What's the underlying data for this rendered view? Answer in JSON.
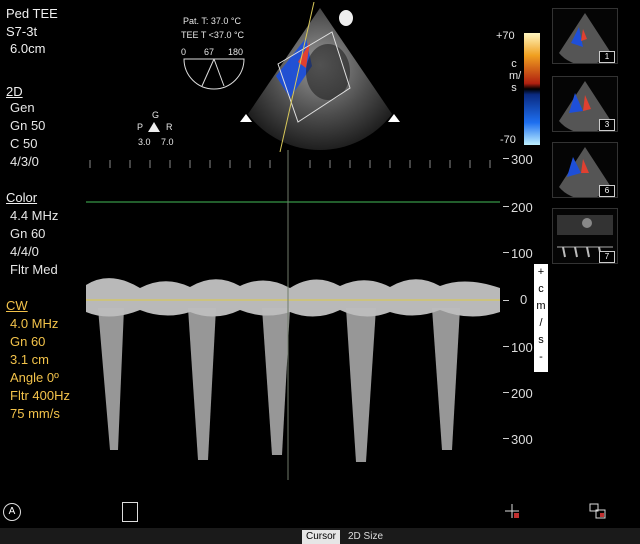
{
  "header": {
    "preset": "Ped TEE",
    "probe": "S7-3t",
    "depth": "6.0cm"
  },
  "temps": {
    "patient": "Pat. T: 37.0 °C",
    "tee": "TEE T <37.0 °C"
  },
  "angle_dial": {
    "min": "0",
    "current": "67",
    "max": "180"
  },
  "orientation": {
    "top": "G",
    "left": "P",
    "right": "R",
    "left_val": "3.0",
    "right_val": "7.0"
  },
  "mode_2d": {
    "title": "2D",
    "lines": [
      "Gen",
      "Gn 50",
      "C 50",
      "4/3/0"
    ]
  },
  "mode_color": {
    "title": "Color",
    "lines": [
      "4.4 MHz",
      "Gn 60",
      "4/4/0",
      "Fltr Med"
    ]
  },
  "mode_cw": {
    "title": "CW",
    "lines": [
      "4.0 MHz",
      "Gn 60",
      "3.1 cm",
      "Angle 0º",
      "Fltr 400Hz",
      "75 mm/s"
    ]
  },
  "color_scale": {
    "max": "+70",
    "min": "-70",
    "unit": "cm/s"
  },
  "velocity_scale": {
    "ticks": [
      "300",
      "200",
      "100",
      "0",
      "100",
      "200",
      "300"
    ],
    "unit_label": [
      "+",
      "c",
      "m",
      "/",
      "s",
      "-"
    ]
  },
  "thumbnails": [
    "1",
    "3",
    "6",
    "7"
  ],
  "bottom_bar": {
    "cursor": "Cursor",
    "size_2d": "2D Size"
  },
  "badge": "A",
  "colors": {
    "cw_text": "#f2c24a",
    "baseline": "#d8c85a",
    "cursor_line": "#2e7d3a",
    "doppler_blue": "#1e4fd8"
  }
}
